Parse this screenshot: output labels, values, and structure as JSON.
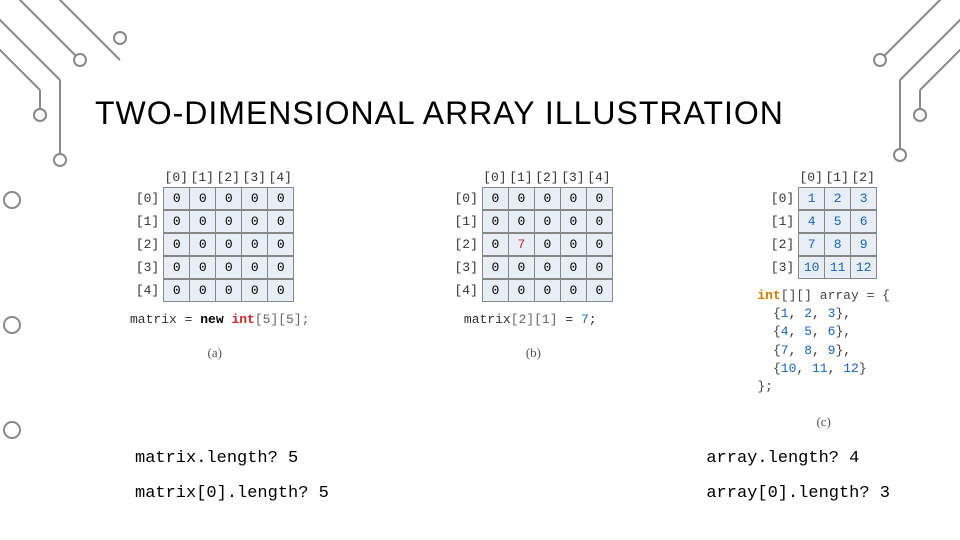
{
  "title": "TWO-DIMENSIONAL ARRAY ILLUSTRATION",
  "panels": {
    "a": {
      "col_hdrs": [
        "[0]",
        "[1]",
        "[2]",
        "[3]",
        "[4]"
      ],
      "row_hdrs": [
        "[0]",
        "[1]",
        "[2]",
        "[3]",
        "[4]"
      ],
      "cells": [
        [
          "0",
          "0",
          "0",
          "0",
          "0"
        ],
        [
          "0",
          "0",
          "0",
          "0",
          "0"
        ],
        [
          "0",
          "0",
          "0",
          "0",
          "0"
        ],
        [
          "0",
          "0",
          "0",
          "0",
          "0"
        ],
        [
          "0",
          "0",
          "0",
          "0",
          "0"
        ]
      ],
      "caption_pre": "matrix = ",
      "caption_kw": "new ",
      "caption_ty": "int",
      "caption_br": "[5][5];",
      "sub": "(a)"
    },
    "b": {
      "col_hdrs": [
        "[0]",
        "[1]",
        "[2]",
        "[3]",
        "[4]"
      ],
      "row_hdrs": [
        "[0]",
        "[1]",
        "[2]",
        "[3]",
        "[4]"
      ],
      "cells": [
        [
          "0",
          "0",
          "0",
          "0",
          "0"
        ],
        [
          "0",
          "0",
          "0",
          "0",
          "0"
        ],
        [
          "0",
          "7",
          "0",
          "0",
          "0"
        ],
        [
          "0",
          "0",
          "0",
          "0",
          "0"
        ],
        [
          "0",
          "0",
          "0",
          "0",
          "0"
        ]
      ],
      "hl": [
        [
          2,
          1
        ]
      ],
      "caption_pre": "matrix",
      "caption_br1": "[2][1]",
      "caption_eq": " = ",
      "caption_nm": "7",
      "caption_sc": ";",
      "sub": "(b)"
    },
    "c": {
      "col_hdrs": [
        "[0]",
        "[1]",
        "[2]"
      ],
      "row_hdrs": [
        "[0]",
        "[1]",
        "[2]",
        "[3]"
      ],
      "cells": [
        [
          "1",
          "2",
          "3"
        ],
        [
          "4",
          "5",
          "6"
        ],
        [
          "7",
          "8",
          "9"
        ],
        [
          "10",
          "11",
          "12"
        ]
      ],
      "code_kw": "int",
      "code_decl": "[][] array = {",
      "code_rows": [
        "{1, 2, 3},",
        "{4, 5, 6},",
        "{7, 8, 9},",
        "{10, 11, 12}"
      ],
      "code_close": "};",
      "sub": "(c)"
    }
  },
  "questions": {
    "left": [
      {
        "q": "matrix.length?",
        "a": "5"
      },
      {
        "q": "matrix[0].length?",
        "a": "5"
      }
    ],
    "right": [
      {
        "q": "array.length?",
        "a": "4"
      },
      {
        "q": "array[0].length?",
        "a": "3"
      }
    ]
  },
  "chart_data": [
    {
      "type": "table",
      "title": "matrix = new int[5][5]",
      "categories": [
        "[0]",
        "[1]",
        "[2]",
        "[3]",
        "[4]"
      ],
      "rows": [
        "[0]",
        "[1]",
        "[2]",
        "[3]",
        "[4]"
      ],
      "values": [
        [
          0,
          0,
          0,
          0,
          0
        ],
        [
          0,
          0,
          0,
          0,
          0
        ],
        [
          0,
          0,
          0,
          0,
          0
        ],
        [
          0,
          0,
          0,
          0,
          0
        ],
        [
          0,
          0,
          0,
          0,
          0
        ]
      ]
    },
    {
      "type": "table",
      "title": "matrix[2][1] = 7",
      "categories": [
        "[0]",
        "[1]",
        "[2]",
        "[3]",
        "[4]"
      ],
      "rows": [
        "[0]",
        "[1]",
        "[2]",
        "[3]",
        "[4]"
      ],
      "values": [
        [
          0,
          0,
          0,
          0,
          0
        ],
        [
          0,
          0,
          0,
          0,
          0
        ],
        [
          0,
          7,
          0,
          0,
          0
        ],
        [
          0,
          0,
          0,
          0,
          0
        ],
        [
          0,
          0,
          0,
          0,
          0
        ]
      ]
    },
    {
      "type": "table",
      "title": "int[][] array = {{1,2,3},{4,5,6},{7,8,9},{10,11,12}}",
      "categories": [
        "[0]",
        "[1]",
        "[2]"
      ],
      "rows": [
        "[0]",
        "[1]",
        "[2]",
        "[3]"
      ],
      "values": [
        [
          1,
          2,
          3
        ],
        [
          4,
          5,
          6
        ],
        [
          7,
          8,
          9
        ],
        [
          10,
          11,
          12
        ]
      ]
    }
  ]
}
